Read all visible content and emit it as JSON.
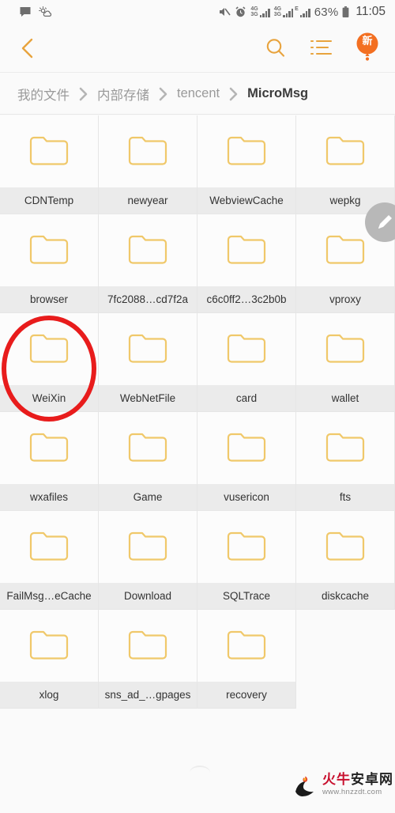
{
  "statusbar": {
    "left_icons": [
      "message-bubble-icon",
      "weather-icon"
    ],
    "mute_icon": "volume-muted-icon",
    "alarm_icon": "alarm-clock-icon",
    "network_1": "4G",
    "network_1_sub": "3G",
    "network_2": "4G",
    "network_2_sub": "3G",
    "network_3": "E",
    "battery_percent": "63%",
    "battery_icon": "battery-icon",
    "time": "11:05"
  },
  "toolbar": {
    "back_label": "back",
    "search_label": "search",
    "list_label": "list-view",
    "badge_text": "新"
  },
  "breadcrumb": {
    "separator": "›",
    "items": [
      {
        "label": "我的文件",
        "current": false
      },
      {
        "label": "内部存储",
        "current": false
      },
      {
        "label": "tencent",
        "current": false
      },
      {
        "label": "MicroMsg",
        "current": true
      }
    ]
  },
  "grid": {
    "columns": 4,
    "items": [
      {
        "name": "CDNTemp",
        "type": "folder",
        "highlighted": false
      },
      {
        "name": "newyear",
        "type": "folder",
        "highlighted": false
      },
      {
        "name": "WebviewCache",
        "type": "folder",
        "highlighted": false
      },
      {
        "name": "wepkg",
        "type": "folder",
        "highlighted": false
      },
      {
        "name": "browser",
        "type": "folder",
        "highlighted": false
      },
      {
        "name": "7fc2088…cd7f2a",
        "type": "folder",
        "highlighted": false
      },
      {
        "name": "c6c0ff2…3c2b0b",
        "type": "folder",
        "highlighted": false
      },
      {
        "name": "vproxy",
        "type": "folder",
        "highlighted": false
      },
      {
        "name": "WeiXin",
        "type": "folder",
        "highlighted": true
      },
      {
        "name": "WebNetFile",
        "type": "folder",
        "highlighted": false
      },
      {
        "name": "card",
        "type": "folder",
        "highlighted": false
      },
      {
        "name": "wallet",
        "type": "folder",
        "highlighted": false
      },
      {
        "name": "wxafiles",
        "type": "folder",
        "highlighted": false
      },
      {
        "name": "Game",
        "type": "folder",
        "highlighted": false
      },
      {
        "name": "vusericon",
        "type": "folder",
        "highlighted": false
      },
      {
        "name": "fts",
        "type": "folder",
        "highlighted": false
      },
      {
        "name": "FailMsg…eCache",
        "type": "folder",
        "highlighted": false
      },
      {
        "name": "Download",
        "type": "folder",
        "highlighted": false
      },
      {
        "name": "SQLTrace",
        "type": "folder",
        "highlighted": false
      },
      {
        "name": "diskcache",
        "type": "folder",
        "highlighted": false
      },
      {
        "name": "xlog",
        "type": "folder",
        "highlighted": false
      },
      {
        "name": "sns_ad_…gpages",
        "type": "folder",
        "highlighted": false
      },
      {
        "name": "recovery",
        "type": "folder",
        "highlighted": false
      }
    ]
  },
  "fab": {
    "icon": "pencil-edit-icon"
  },
  "annotation": {
    "shape": "ellipse",
    "color": "#e81c1c",
    "target": "WeiXin"
  },
  "watermark": {
    "site_red": "火牛",
    "site_black": "安卓网",
    "url": "www.hnzzdt.com"
  },
  "colors": {
    "accent": "#e8a33d",
    "folder": "#f0c86a",
    "annotation": "#e81c1c",
    "background": "#fafafa",
    "label_strip": "#ebebeb"
  }
}
